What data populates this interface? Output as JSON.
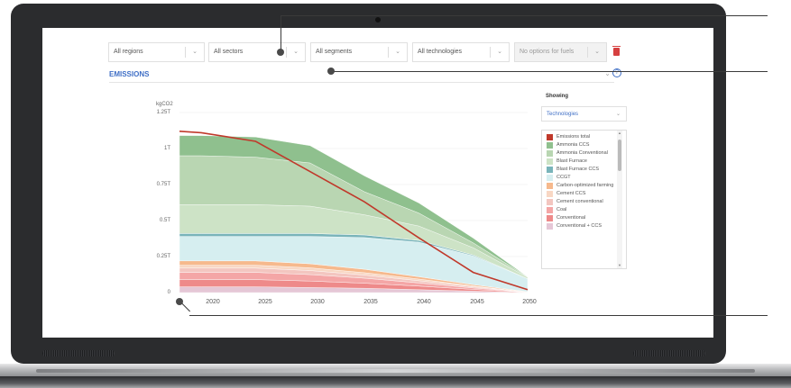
{
  "filters": [
    {
      "label": "All regions",
      "disabled": false
    },
    {
      "label": "All sectors",
      "disabled": false
    },
    {
      "label": "All segments",
      "disabled": false
    },
    {
      "label": "All technologies",
      "disabled": false
    },
    {
      "label": "No options for fuels",
      "disabled": true
    }
  ],
  "section": {
    "title": "EMISSIONS"
  },
  "chart_data": {
    "type": "area",
    "stacked": true,
    "unit": "kgCO2",
    "y_tick_labels": [
      "0",
      "0.25T",
      "0.5T",
      "0.75T",
      "1T",
      "1.25T"
    ],
    "y_tick_values": [
      0,
      0.25,
      0.5,
      0.75,
      1.0,
      1.25
    ],
    "ylim": [
      0,
      1.25
    ],
    "x": [
      2020,
      2025,
      2030,
      2035,
      2040,
      2045,
      2050
    ],
    "xlim": [
      2018,
      2050
    ],
    "x_tick_labels": [
      "2020",
      "2025",
      "2030",
      "2035",
      "2040",
      "2045",
      "2050"
    ],
    "total_series": {
      "name": "Emissions total",
      "color": "#c0392b",
      "x": [
        2018,
        2020,
        2025,
        2030,
        2035,
        2040,
        2045,
        2050
      ],
      "values": [
        1.12,
        1.11,
        1.05,
        0.84,
        0.63,
        0.38,
        0.14,
        0.02
      ]
    },
    "series": [
      {
        "name": "Conventional + CCS",
        "color": "#e5c7d6",
        "values": [
          0.04,
          0.04,
          0.035,
          0.03,
          0.02,
          0.01,
          0.0
        ]
      },
      {
        "name": "Conventional",
        "color": "#ee8a8a",
        "values": [
          0.05,
          0.05,
          0.045,
          0.035,
          0.025,
          0.012,
          0.002
        ]
      },
      {
        "name": "Coal",
        "color": "#f4a6a6",
        "values": [
          0.05,
          0.05,
          0.045,
          0.035,
          0.022,
          0.01,
          0.0
        ]
      },
      {
        "name": "Cement conventional",
        "color": "#f3c6c0",
        "values": [
          0.03,
          0.03,
          0.028,
          0.022,
          0.015,
          0.008,
          0.001
        ]
      },
      {
        "name": "Cement CCS",
        "color": "#f8d7c4",
        "values": [
          0.02,
          0.02,
          0.019,
          0.016,
          0.012,
          0.006,
          0.001
        ]
      },
      {
        "name": "Carbon-optimized farming",
        "color": "#f6b98d",
        "values": [
          0.03,
          0.03,
          0.028,
          0.024,
          0.016,
          0.009,
          0.002
        ]
      },
      {
        "name": "CCGT",
        "color": "#d6eef0",
        "values": [
          0.17,
          0.17,
          0.19,
          0.22,
          0.24,
          0.2,
          0.09
        ]
      },
      {
        "name": "Blast Furnace CCS",
        "color": "#79b4ba",
        "values": [
          0.02,
          0.02,
          0.02,
          0.018,
          0.012,
          0.006,
          0.0
        ]
      },
      {
        "name": "Blast Furnace",
        "color": "#cde3c6",
        "values": [
          0.2,
          0.2,
          0.19,
          0.14,
          0.1,
          0.05,
          0.01
        ]
      },
      {
        "name": "Ammonia Conventional",
        "color": "#b9d6b2",
        "values": [
          0.34,
          0.33,
          0.3,
          0.16,
          0.09,
          0.034,
          0.003
        ]
      },
      {
        "name": "Ammonia CCS",
        "color": "#8fc08e",
        "values": [
          0.14,
          0.14,
          0.12,
          0.11,
          0.07,
          0.033,
          0.0
        ]
      }
    ]
  },
  "legend": {
    "showing_label": "Showing",
    "showing_value": "Technologies",
    "items": [
      {
        "label": "Emissions total",
        "color": "#c0392b"
      },
      {
        "label": "Ammonia CCS",
        "color": "#8fc08e"
      },
      {
        "label": "Ammonia Conventional",
        "color": "#b9d6b2"
      },
      {
        "label": "Blast Furnace",
        "color": "#cde3c6"
      },
      {
        "label": "Blast Furnace CCS",
        "color": "#79b4ba"
      },
      {
        "label": "CCGT",
        "color": "#d6eef0"
      },
      {
        "label": "Carbon-optimized farming",
        "color": "#f6b98d"
      },
      {
        "label": "Cement CCS",
        "color": "#f8d7c4"
      },
      {
        "label": "Cement conventional",
        "color": "#f3c6c0"
      },
      {
        "label": "Coal",
        "color": "#f4a6a6"
      },
      {
        "label": "Conventional",
        "color": "#ee8a8a"
      },
      {
        "label": "Conventional + CCS",
        "color": "#e5c7d6"
      }
    ]
  },
  "colors": {
    "accent": "#3f6fc6",
    "frame": "#2b2c2e",
    "delete": "#d64040"
  }
}
